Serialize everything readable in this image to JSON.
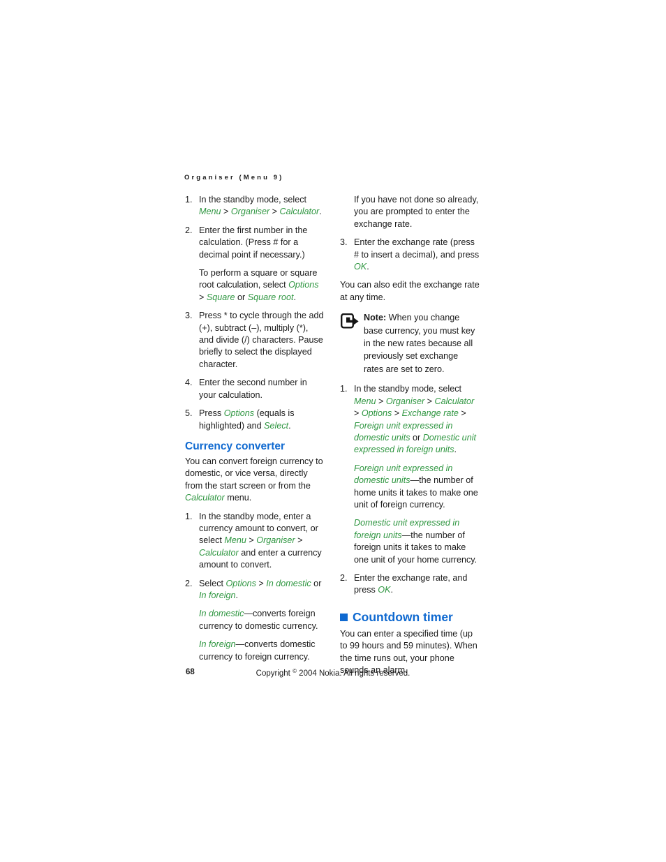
{
  "document": {
    "running_header": "Organiser (Menu 9)",
    "colors": {
      "ui_term_green": "#2f9641",
      "heading_blue": "#0f69d0",
      "body_text": "#1a1a1a"
    }
  },
  "left_column": {
    "step1": {
      "num": "1.",
      "t1": "In the standby mode, select ",
      "ui1": "Menu",
      "sep1": " > ",
      "ui2": "Organiser",
      "sep2": " > ",
      "ui3": "Calculator",
      "t2": "."
    },
    "step2": {
      "num": "2.",
      "t1": "Enter the first number in the calculation. (Press # for a decimal point if necessary.)"
    },
    "step2_sub": {
      "t1": "To perform a square or square root calculation, select ",
      "ui1": "Options",
      "sep1": " > ",
      "ui2": "Square",
      "t2": " or ",
      "ui3": "Square root",
      "t3": "."
    },
    "step3": {
      "num": "3.",
      "t1": "Press * to cycle through the add (+), subtract (–), multiply (*), and divide (/) characters. Pause briefly to select the displayed character."
    },
    "step4": {
      "num": "4.",
      "t1": "Enter the second number in your calculation."
    },
    "step5": {
      "num": "5.",
      "t1": "Press ",
      "ui1": "Options",
      "t2": " (equals is highlighted) and ",
      "ui2": "Select",
      "t3": "."
    },
    "currency_heading": "Currency converter",
    "currency_intro": {
      "t1": "You can convert foreign currency to domestic, or vice versa, directly from the start screen or from the ",
      "ui1": "Calculator",
      "t2": " menu."
    },
    "cc_step1": {
      "num": "1.",
      "t1": "In the standby mode, enter a currency amount to convert, or select ",
      "ui1": "Menu",
      "sep1": " > ",
      "ui2": "Organiser",
      "sep2": " > ",
      "ui3": "Calculator",
      "t2": " and enter a currency amount to convert."
    },
    "cc_step2": {
      "num": "2.",
      "t1": "Select ",
      "ui1": "Options",
      "sep1": " > ",
      "ui2": "In domestic",
      "t2": " or ",
      "ui3": "In foreign",
      "t3": "."
    },
    "cc_def1": {
      "ui1": "In domestic",
      "t1": "—converts foreign currency to domestic currency."
    },
    "cc_def2": {
      "ui1": "In foreign",
      "t1": "—converts domestic currency to foreign currency."
    }
  },
  "right_column": {
    "cont_para": "If you have not done so already, you are prompted to enter the exchange rate.",
    "step3": {
      "num": "3.",
      "t1": "Enter the exchange rate (press # to insert a decimal), and press ",
      "ui1": "OK",
      "t2": "."
    },
    "edit_para": "You can also edit the exchange rate at any time.",
    "note": {
      "icon": "note-pointer-icon",
      "label": "Note:",
      "text": " When you change base currency, you must key in the new rates because all previously set exchange rates are set to zero."
    },
    "er_step1": {
      "num": "1.",
      "t1": "In the standby mode, select ",
      "ui1": "Menu",
      "sep1": " > ",
      "ui2": "Organiser",
      "sep2": " > ",
      "ui3": "Calculator",
      "sep3": " > ",
      "ui4": "Options",
      "sep4": " > ",
      "ui5": "Exchange rate",
      "sep5": " > ",
      "ui6": "Foreign unit expressed in domestic units",
      "t2": " or ",
      "ui7": "Domestic unit expressed in foreign units",
      "t3": "."
    },
    "er_def1": {
      "ui1": "Foreign unit expressed in domestic units",
      "t1": "—the number of home units it takes to make one unit of foreign currency."
    },
    "er_def2": {
      "ui1": "Domestic unit expressed in foreign units",
      "t1": "—the number of foreign units it takes to make one unit of your home currency."
    },
    "er_step2": {
      "num": "2.",
      "t1": "Enter the exchange rate, and press ",
      "ui1": "OK",
      "t2": "."
    },
    "countdown_heading": "Countdown timer",
    "countdown_para": "You can enter a specified time (up to 99 hours and 59 minutes). When the time runs out, your phone sounds an alarm."
  },
  "footer": {
    "page_number": "68",
    "copyright_before": "Copyright ",
    "copyright_symbol": "©",
    "copyright_after": " 2004 Nokia. All rights reserved."
  }
}
